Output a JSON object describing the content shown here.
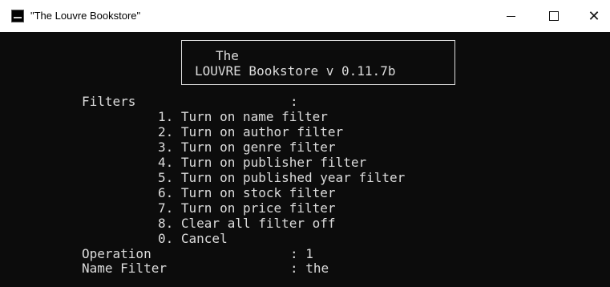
{
  "window": {
    "title": "\"The Louvre Bookstore\"",
    "minimize_icon": "minimize-icon",
    "maximize_icon": "maximize-icon",
    "close_icon": "close-icon"
  },
  "banner": {
    "line1": "The",
    "line2": "LOUVRE Bookstore v 0.11.7b"
  },
  "console": {
    "filters_label": "Filters",
    "filters_colon": ":",
    "options": [
      "1. Turn on name filter",
      "2. Turn on author filter",
      "3. Turn on genre filter",
      "4. Turn on publisher filter",
      "5. Turn on published year filter",
      "6. Turn on stock filter",
      "7. Turn on price filter",
      "8. Clear all filter off",
      "0. Cancel"
    ],
    "operation_label": "Operation",
    "operation_value": ": 1",
    "name_filter_label": "Name Filter",
    "name_filter_value": ": the"
  },
  "colors": {
    "console_bg": "#0c0c0c",
    "console_fg": "#dcdcdc",
    "titlebar_bg": "#ffffff"
  }
}
